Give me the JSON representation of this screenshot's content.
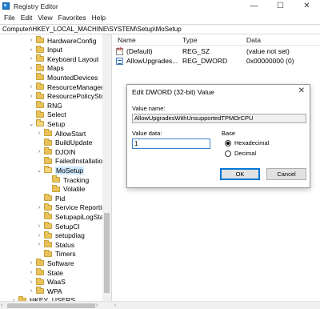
{
  "window": {
    "title": "Registry Editor",
    "minimize": "—",
    "maximize": "☐",
    "close": "✕"
  },
  "menu": [
    "File",
    "Edit",
    "View",
    "Favorites",
    "Help"
  ],
  "address": "Computer\\HKEY_LOCAL_MACHINE\\SYSTEM\\Setup\\MoSetup",
  "tree": [
    {
      "label": "HardwareConfig",
      "level": 0,
      "expander": "›"
    },
    {
      "label": "Input",
      "level": 0,
      "expander": "›"
    },
    {
      "label": "Keyboard Layout",
      "level": 0,
      "expander": "›"
    },
    {
      "label": "Maps",
      "level": 0,
      "expander": "›"
    },
    {
      "label": "MountedDevices",
      "level": 0,
      "expander": ""
    },
    {
      "label": "ResourceManager",
      "level": 0,
      "expander": "›"
    },
    {
      "label": "ResourcePolicyStore",
      "level": 0,
      "expander": "›"
    },
    {
      "label": "RNG",
      "level": 0,
      "expander": ""
    },
    {
      "label": "Select",
      "level": 0,
      "expander": ""
    },
    {
      "label": "Setup",
      "level": 0,
      "expander": "⌄"
    },
    {
      "label": "AllowStart",
      "level": 1,
      "expander": "›"
    },
    {
      "label": "BuildUpdate",
      "level": 1,
      "expander": ""
    },
    {
      "label": "DJOIN",
      "level": 1,
      "expander": "›"
    },
    {
      "label": "FailedInstallations",
      "level": 1,
      "expander": ""
    },
    {
      "label": "MoSetup",
      "level": 1,
      "expander": "⌄",
      "selected": true
    },
    {
      "label": "Tracking",
      "level": 2,
      "expander": ""
    },
    {
      "label": "Volatile",
      "level": 2,
      "expander": ""
    },
    {
      "label": "Pid",
      "level": 1,
      "expander": ""
    },
    {
      "label": "Service Reporting A",
      "level": 1,
      "expander": "›"
    },
    {
      "label": "SetupapiLogStatus",
      "level": 1,
      "expander": ""
    },
    {
      "label": "SetupCI",
      "level": 1,
      "expander": "›"
    },
    {
      "label": "setupdiag",
      "level": 1,
      "expander": "›"
    },
    {
      "label": "Status",
      "level": 1,
      "expander": "›"
    },
    {
      "label": "Timers",
      "level": 1,
      "expander": ""
    },
    {
      "label": "Software",
      "level": 0,
      "expander": "›"
    },
    {
      "label": "State",
      "level": 0,
      "expander": "›"
    },
    {
      "label": "WaaS",
      "level": 0,
      "expander": "›"
    },
    {
      "label": "WPA",
      "level": 0,
      "expander": "›"
    },
    {
      "label": "HKEY_USERS",
      "level": -1,
      "expander": "›"
    }
  ],
  "values_header": {
    "name": "Name",
    "type": "Type",
    "data": "Data"
  },
  "values": [
    {
      "name": "(Default)",
      "type": "REG_SZ",
      "data": "(value not set)",
      "icon": "string-value-icon"
    },
    {
      "name": "AllowUpgrades...",
      "type": "REG_DWORD",
      "data": "0x00000000 (0)",
      "icon": "dword-value-icon"
    }
  ],
  "dialog": {
    "title": "Edit DWORD (32-bit) Value",
    "close": "✕",
    "value_name_label": "Value name:",
    "value_name": "AllowUpgradesWithUnsupportedTPMOrCPU",
    "value_data_label": "Value data:",
    "value_data": "1",
    "base_label": "Base",
    "base_options": [
      {
        "label": "Hexadecimal",
        "checked": true
      },
      {
        "label": "Decimal",
        "checked": false
      }
    ],
    "ok": "OK",
    "cancel": "Cancel"
  },
  "watermark": "infokie",
  "scroll": {
    "left": "‹",
    "right": "›"
  }
}
